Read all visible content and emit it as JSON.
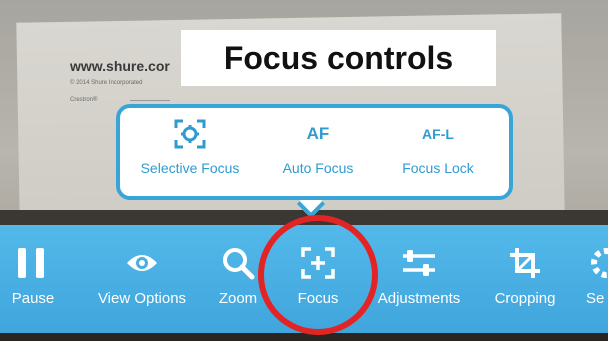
{
  "page": {
    "title": "Focus controls"
  },
  "background_doc": {
    "url_text": "www.shure.cor",
    "copyright_text": "© 2014 Shure Incorporated",
    "crestron_text": "Crestron®"
  },
  "popup": {
    "items": [
      {
        "label": "Selective Focus",
        "icon": "selective-focus-icon"
      },
      {
        "label": "Auto Focus",
        "icon_text": "AF"
      },
      {
        "label": "Focus Lock",
        "icon_text": "AF-L"
      }
    ]
  },
  "toolbar": {
    "items": [
      {
        "label": "Pause",
        "icon": "pause-icon"
      },
      {
        "label": "View Options",
        "icon": "eye-icon"
      },
      {
        "label": "Zoom",
        "icon": "magnifier-icon"
      },
      {
        "label": "Focus",
        "icon": "focus-icon",
        "selected": true
      },
      {
        "label": "Adjustments",
        "icon": "sliders-icon"
      },
      {
        "label": "Cropping",
        "icon": "crop-icon"
      },
      {
        "label": "Se",
        "icon": "settings-icon"
      }
    ]
  },
  "colors": {
    "toolbar": "#4aaee3",
    "popup_accent": "#39a5d6",
    "highlight": "#e32424"
  }
}
